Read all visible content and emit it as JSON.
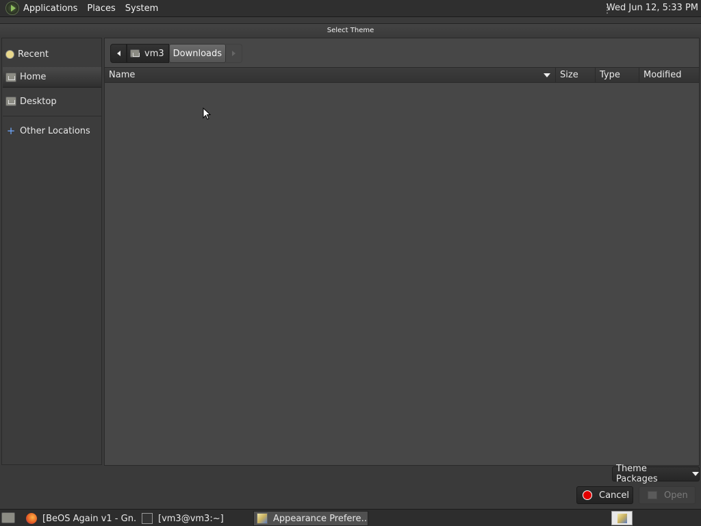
{
  "top_panel": {
    "menus": [
      "Applications",
      "Places",
      "System"
    ],
    "clock": "Wed Jun 12,  5:33 PM"
  },
  "window": {
    "title": "Select Theme"
  },
  "sidebar": {
    "items": [
      {
        "label": "Recent",
        "icon": "recent-icon"
      },
      {
        "label": "Home",
        "icon": "home-folder-icon",
        "active": true
      },
      {
        "label": "Desktop",
        "icon": "desktop-folder-icon"
      },
      {
        "label": "Other Locations",
        "icon": "other-locations-icon"
      }
    ]
  },
  "pathbar": {
    "segments": [
      "vm3",
      "Downloads"
    ],
    "current": "Downloads"
  },
  "file_list": {
    "columns": [
      "Name",
      "Size",
      "Type",
      "Modified"
    ],
    "sort_column": "Name",
    "rows": []
  },
  "filter": {
    "label": "Theme Packages"
  },
  "buttons": {
    "cancel": "Cancel",
    "open": "Open"
  },
  "taskbar": {
    "tasks": [
      {
        "label": "[BeOS Again v1 - Gn…",
        "icon": "firefox-icon"
      },
      {
        "label": "[vm3@vm3:~]",
        "icon": "terminal-icon"
      },
      {
        "label": "Appearance Prefere…",
        "icon": "appearance-preferences-icon",
        "active": true
      }
    ]
  },
  "colors": {
    "panel_bg": "#2f2f2f",
    "window_bg": "#3a3a3a",
    "list_bg": "#474747",
    "cancel_icon": "#e00000"
  }
}
